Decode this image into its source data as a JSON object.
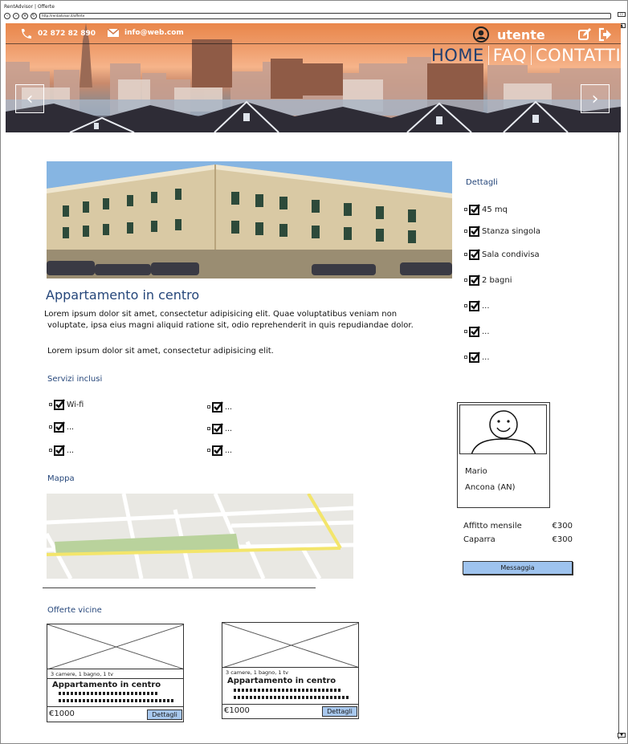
{
  "browser": {
    "window_title": "RentAdvisor | Offerte",
    "url": "http://rentadvisor.it/offerte"
  },
  "header": {
    "phone": "02 872 82 890",
    "email": "info@web.com",
    "username": "utente",
    "menu": [
      {
        "label": "HOME",
        "active": true
      },
      {
        "label": "FAQ",
        "active": false
      },
      {
        "label": "CONTATTI",
        "active": false
      }
    ]
  },
  "listing": {
    "title": "Appartamento in centro",
    "description_1": "Lorem ipsum dolor sit amet, consectetur adipisicing elit. Quae voluptatibus veniam non",
    "description_2": "voluptate, ipsa eius magni aliquid ratione sit, odio reprehenderit in quis repudiandae dolor.",
    "description_3": "Lorem ipsum dolor sit amet, consectetur adipisicing elit."
  },
  "services": {
    "heading": "Servizi inclusi",
    "items": [
      "Wi-fi",
      "...",
      "...",
      "...",
      "...",
      "..."
    ]
  },
  "map": {
    "heading": "Mappa"
  },
  "details": {
    "heading": "Dettagli",
    "items": [
      "45 mq",
      "Stanza singola",
      "Sala condivisa",
      "2 bagni",
      "...",
      "...",
      "..."
    ]
  },
  "owner": {
    "name": "Mario",
    "city": "Ancona (AN)"
  },
  "pricing": {
    "rent_label": "Affitto mensile",
    "rent_value": "€300",
    "deposit_label": "Caparra",
    "deposit_value": "€300",
    "message_button": "Messaggia"
  },
  "nearby": {
    "heading": "Offerte vicine",
    "cards": [
      {
        "meta": "3 camere, 1 bagno, 1 tv",
        "title": "Appartamento in centro",
        "price": "€1000",
        "button": "Dettagli"
      },
      {
        "meta": "3 camere, 1 bagno, 1 tv",
        "title": "Appartamento in centro",
        "price": "€1000",
        "button": "Dettagli"
      }
    ]
  },
  "colors": {
    "accent": "#25467a",
    "button": "#9ec3ee"
  }
}
